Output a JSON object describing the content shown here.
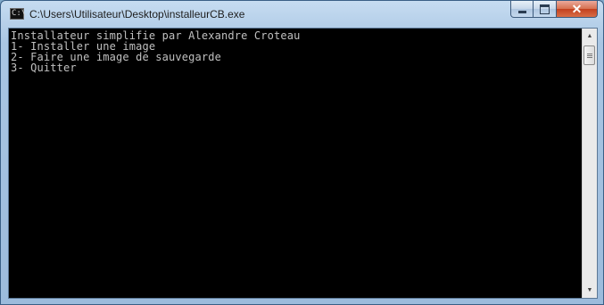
{
  "window": {
    "title": "C:\\Users\\Utilisateur\\Desktop\\installeurCB.exe",
    "icon": "console-icon",
    "controls": {
      "minimize": "minimize-icon",
      "maximize": "maximize-icon",
      "close": "close-icon"
    }
  },
  "console": {
    "lines": [
      "Installateur simplifie par Alexandre Croteau",
      "1- Installer une image",
      "2- Faire une image de sauvegarde",
      "3- Quitter"
    ],
    "background": "#000000",
    "text_color": "#C0C0C0"
  },
  "scrollbar": {
    "up_icon": "scroll-up-arrow-icon",
    "down_icon": "scroll-down-arrow-icon"
  },
  "colors": {
    "frame": "#A9C6E3",
    "close_button": "#C3401F"
  }
}
